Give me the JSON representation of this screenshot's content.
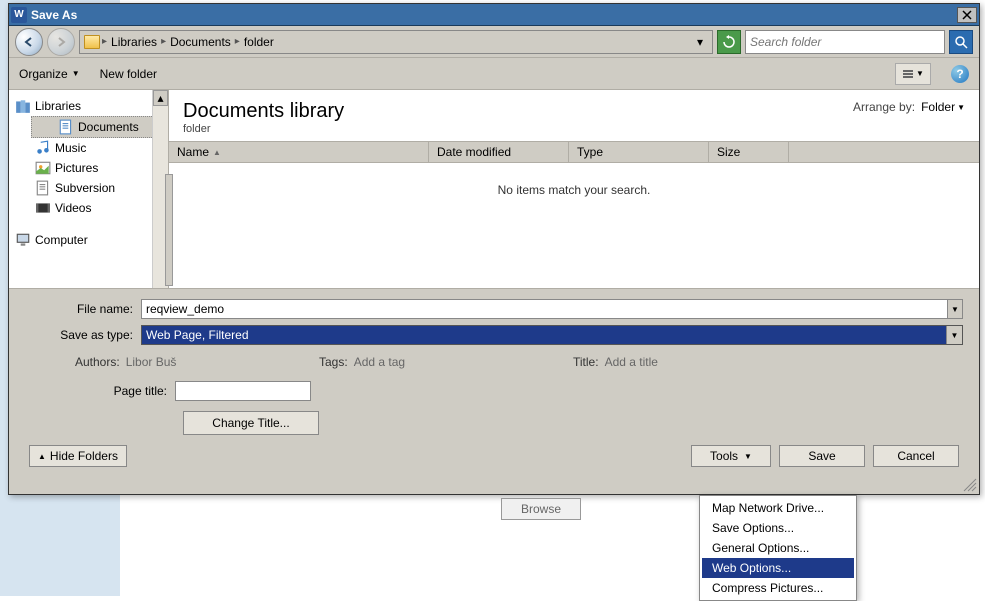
{
  "window": {
    "title": "Save As",
    "close": "✕"
  },
  "nav": {
    "crumbs": [
      "Libraries",
      "Documents",
      "folder"
    ],
    "search_placeholder": "Search folder"
  },
  "toolbar": {
    "organize": "Organize",
    "new_folder": "New folder",
    "help": "?"
  },
  "sidebar": {
    "libraries": "Libraries",
    "items": [
      {
        "label": "Documents"
      },
      {
        "label": "Music"
      },
      {
        "label": "Pictures"
      },
      {
        "label": "Subversion"
      },
      {
        "label": "Videos"
      }
    ],
    "computer": "Computer"
  },
  "main": {
    "title": "Documents library",
    "subtitle": "folder",
    "arrange_label": "Arrange by:",
    "arrange_value": "Folder",
    "columns": {
      "name": "Name",
      "date": "Date modified",
      "type": "Type",
      "size": "Size"
    },
    "empty": "No items match your search."
  },
  "form": {
    "filename_label": "File name:",
    "filename_value": "reqview_demo",
    "savetype_label": "Save as type:",
    "savetype_value": "Web Page, Filtered",
    "authors_label": "Authors:",
    "authors_value": "Libor Buš",
    "tags_label": "Tags:",
    "tags_value": "Add a tag",
    "title_label": "Title:",
    "title_value": "Add a title",
    "pagetitle_label": "Page title:",
    "change_title": "Change Title...",
    "hide_folders": "Hide Folders",
    "tools": "Tools",
    "save": "Save",
    "cancel": "Cancel"
  },
  "tools_menu": [
    "Map Network Drive...",
    "Save Options...",
    "General Options...",
    "Web Options...",
    "Compress Pictures..."
  ],
  "behind": {
    "browse": "Browse"
  }
}
